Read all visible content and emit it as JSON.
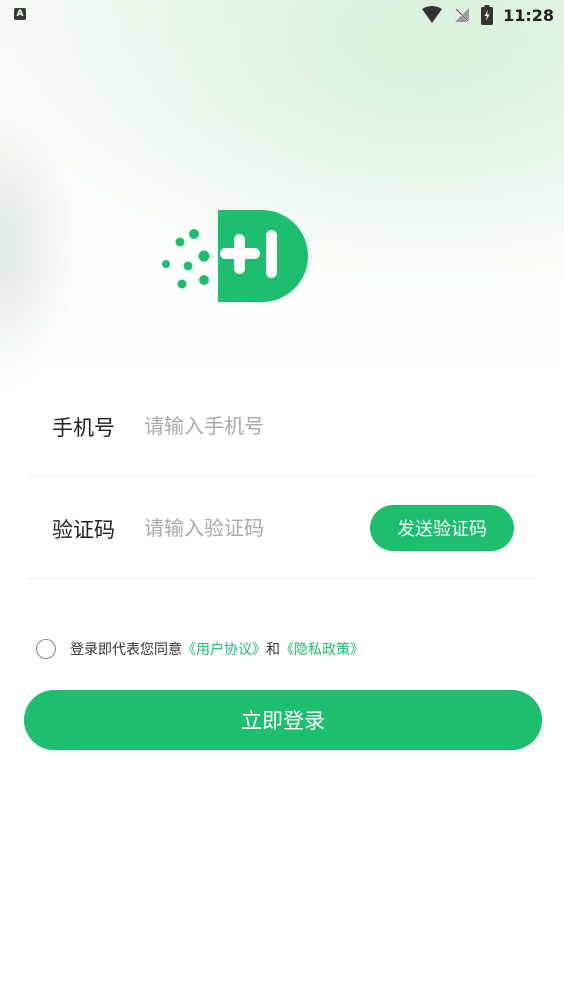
{
  "status_bar": {
    "app_icon_letter": "A",
    "time": "11:28",
    "icons": [
      "wifi-icon",
      "no-signal-icon",
      "battery-charging-icon"
    ]
  },
  "logo": {
    "icon": "brand-logo-icon",
    "color": "#1dbf6e"
  },
  "form": {
    "phone": {
      "label": "手机号",
      "placeholder": "请输入手机号"
    },
    "code": {
      "label": "验证码",
      "placeholder": "请输入验证码",
      "send_button": "发送验证码"
    }
  },
  "agreement": {
    "prefix": "登录即代表您同意",
    "user_agreement": "《用户协议》",
    "conjunction": "和",
    "privacy_policy": "《隐私政策》",
    "checked": false
  },
  "login_button": "立即登录",
  "colors": {
    "accent": "#1dbf6e",
    "divider": "#eeeeee",
    "placeholder": "#a9a9a9"
  }
}
